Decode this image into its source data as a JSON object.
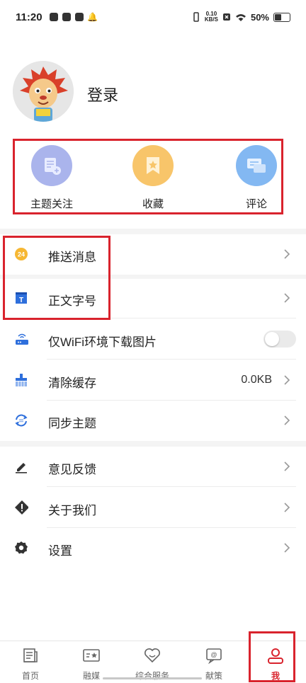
{
  "status_bar": {
    "time": "11:20",
    "net_speed_top": "0.10",
    "net_speed_bottom": "KB/S",
    "battery": "50%"
  },
  "profile": {
    "login_label": "登录"
  },
  "quick_actions": [
    {
      "label": "主题关注",
      "icon": "topic-follow-icon"
    },
    {
      "label": "收藏",
      "icon": "favorites-icon"
    },
    {
      "label": "评论",
      "icon": "comment-icon"
    }
  ],
  "settings": [
    {
      "label": "推送消息",
      "icon": "push-24-icon"
    },
    {
      "label": "正文字号",
      "icon": "font-size-icon"
    },
    {
      "label": "仅WiFi环境下载图片",
      "icon": "router-icon",
      "toggle": false
    },
    {
      "label": "清除缓存",
      "icon": "broom-icon",
      "value": "0.0KB"
    },
    {
      "label": "同步主题",
      "icon": "sync-icon"
    },
    {
      "label": "意见反馈",
      "icon": "pencil-icon"
    },
    {
      "label": "关于我们",
      "icon": "info-diamond-icon"
    },
    {
      "label": "设置",
      "icon": "gear-icon"
    }
  ],
  "nav": [
    {
      "label": "首页",
      "icon": "news-icon"
    },
    {
      "label": "融媒",
      "icon": "media-icon"
    },
    {
      "label": "综合服务",
      "icon": "heart-service-icon"
    },
    {
      "label": "献策",
      "icon": "suggest-icon"
    },
    {
      "label": "我",
      "icon": "user-icon",
      "active": true
    }
  ],
  "colors": {
    "accent": "#d9232d",
    "topic": "#aab4ec",
    "favorite": "#f8c56a",
    "comment": "#83b8f2"
  }
}
